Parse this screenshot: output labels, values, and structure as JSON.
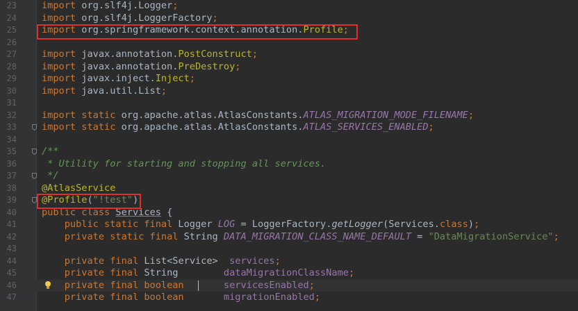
{
  "lines": [
    {
      "n": "23",
      "parts": [
        [
          "kw",
          "import"
        ],
        [
          "p",
          " org.slf4j.Logger"
        ],
        [
          "kw",
          ";"
        ]
      ]
    },
    {
      "n": "24",
      "parts": [
        [
          "kw",
          "import"
        ],
        [
          "p",
          " org.slf4j.LoggerFactory"
        ],
        [
          "kw",
          ";"
        ]
      ]
    },
    {
      "n": "25",
      "parts": [
        [
          "kw",
          "import"
        ],
        [
          "p",
          " org.springframework.context.annotation."
        ],
        [
          "cls",
          "Profile"
        ],
        [
          "kw",
          ";"
        ]
      ]
    },
    {
      "n": "26",
      "parts": []
    },
    {
      "n": "27",
      "parts": [
        [
          "kw",
          "import"
        ],
        [
          "p",
          " javax.annotation."
        ],
        [
          "cls",
          "PostConstruct"
        ],
        [
          "kw",
          ";"
        ]
      ]
    },
    {
      "n": "28",
      "parts": [
        [
          "kw",
          "import"
        ],
        [
          "p",
          " javax.annotation."
        ],
        [
          "cls",
          "PreDestroy"
        ],
        [
          "kw",
          ";"
        ]
      ]
    },
    {
      "n": "29",
      "parts": [
        [
          "kw",
          "import"
        ],
        [
          "p",
          " javax.inject."
        ],
        [
          "cls",
          "Inject"
        ],
        [
          "kw",
          ";"
        ]
      ]
    },
    {
      "n": "30",
      "parts": [
        [
          "kw",
          "import"
        ],
        [
          "p",
          " java.util.List"
        ],
        [
          "kw",
          ";"
        ]
      ]
    },
    {
      "n": "31",
      "parts": []
    },
    {
      "n": "32",
      "parts": [
        [
          "kw",
          "import static"
        ],
        [
          "p",
          " org.apache.atlas.AtlasConstants."
        ],
        [
          "cn",
          "ATLAS_MIGRATION_MODE_FILENAME"
        ],
        [
          "kw",
          ";"
        ]
      ]
    },
    {
      "n": "33",
      "parts": [
        [
          "kw",
          "import static"
        ],
        [
          "p",
          " org.apache.atlas.AtlasConstants."
        ],
        [
          "cn",
          "ATLAS_SERVICES_ENABLED"
        ],
        [
          "kw",
          ";"
        ]
      ]
    },
    {
      "n": "34",
      "parts": []
    },
    {
      "n": "35",
      "parts": [
        [
          "cmt",
          "/**"
        ]
      ]
    },
    {
      "n": "36",
      "parts": [
        [
          "cmt",
          " * Utility for starting and stopping all services."
        ]
      ]
    },
    {
      "n": "37",
      "parts": [
        [
          "cmt",
          " */"
        ]
      ]
    },
    {
      "n": "38",
      "parts": [
        [
          "ann",
          "@AtlasService"
        ]
      ]
    },
    {
      "n": "39",
      "parts": [
        [
          "ann",
          "@Profile"
        ],
        [
          "p",
          "("
        ],
        [
          "str",
          "\"!test\""
        ],
        [
          "p",
          ")"
        ]
      ]
    },
    {
      "n": "40",
      "parts": [
        [
          "kw",
          "public class"
        ],
        [
          "p",
          " "
        ],
        [
          "ul",
          "Services"
        ],
        [
          "p",
          " {"
        ]
      ]
    },
    {
      "n": "41",
      "parts": [
        [
          "p",
          "    "
        ],
        [
          "kw",
          "public static final"
        ],
        [
          "p",
          " Logger "
        ],
        [
          "cn",
          "LOG"
        ],
        [
          "p",
          " = LoggerFactory."
        ],
        [
          "it",
          "getLogger"
        ],
        [
          "p",
          "(Services."
        ],
        [
          "kw",
          "class"
        ],
        [
          "p",
          ")"
        ],
        [
          "kw",
          ";"
        ]
      ]
    },
    {
      "n": "42",
      "parts": [
        [
          "p",
          "    "
        ],
        [
          "kw",
          "private static final"
        ],
        [
          "p",
          " String "
        ],
        [
          "cn",
          "DATA_MIGRATION_CLASS_NAME_DEFAULT"
        ],
        [
          "p",
          " = "
        ],
        [
          "str",
          "\"DataMigrationService\""
        ],
        [
          "kw",
          ";"
        ]
      ]
    },
    {
      "n": "43",
      "parts": []
    },
    {
      "n": "44",
      "parts": [
        [
          "p",
          "    "
        ],
        [
          "kw",
          "private final"
        ],
        [
          "p",
          " List<Service>  "
        ],
        [
          "field",
          "services"
        ],
        [
          "kw",
          ";"
        ]
      ]
    },
    {
      "n": "45",
      "parts": [
        [
          "p",
          "    "
        ],
        [
          "kw",
          "private final"
        ],
        [
          "p",
          " String        "
        ],
        [
          "field",
          "dataMigrationClassName"
        ],
        [
          "kw",
          ";"
        ]
      ]
    },
    {
      "n": "46",
      "parts": [
        [
          "p",
          "    "
        ],
        [
          "kw",
          "private final boolean"
        ],
        [
          "p",
          "       "
        ],
        [
          "field",
          "servicesEnabled"
        ],
        [
          "kw",
          ";"
        ]
      ],
      "current": true
    },
    {
      "n": "47",
      "parts": [
        [
          "p",
          "    "
        ],
        [
          "kw",
          "private final boolean"
        ],
        [
          "p",
          "       "
        ],
        [
          "field",
          "migrationEnabled"
        ],
        [
          "kw",
          ";"
        ]
      ]
    }
  ],
  "fold_lines": [
    "33",
    "35",
    "37",
    "39"
  ],
  "bulb_line": "46",
  "highlight_color": "#e0302e"
}
